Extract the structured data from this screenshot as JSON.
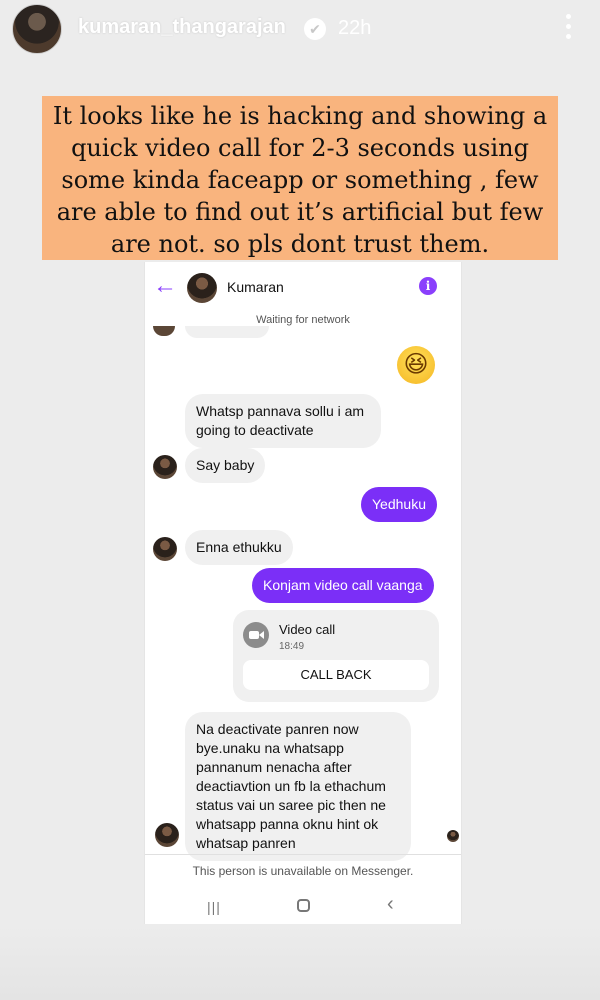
{
  "story": {
    "username": "kumaran_thangarajan",
    "verified_glyph": "✔",
    "time": "22h",
    "caption": "It looks like he is hacking and showing a quick video call for 2-3 seconds using some kinda faceapp or something , few are able to find out it’s artificial but few are not. so pls dont trust them.",
    "caption_bg": "#f9b47e",
    "icons": [
      "avatar",
      "verified-badge-icon",
      "more-options-icon"
    ]
  },
  "messenger": {
    "contact_name": "Kumaran",
    "status": "Waiting for network",
    "back_glyph": "←",
    "info_glyph": "i",
    "accent_color": "#7b2ff7",
    "emoji": "😆",
    "messages": [
      {
        "from": "them",
        "text": "Whatsp pannava sollu i am going to deactivate"
      },
      {
        "from": "them",
        "text": "Say baby"
      },
      {
        "from": "me",
        "text": "Yedhuku"
      },
      {
        "from": "them",
        "text": "Enna ethukku"
      },
      {
        "from": "me",
        "text": "Konjam video call vaanga"
      },
      {
        "from": "them",
        "text": "Na deactivate panren now bye.unaku na whatsapp pannanum nenacha after deactiavtion un fb la ethachum status vai un saree pic then ne whatsapp panna oknu hint ok whatsap panren"
      }
    ],
    "call": {
      "title": "Video call",
      "time": "18:49",
      "action": "CALL BACK"
    },
    "footer_notice": "This person is unavailable on Messenger.",
    "nav": {
      "recents_glyph": "|||",
      "back_glyph": "‹"
    }
  }
}
